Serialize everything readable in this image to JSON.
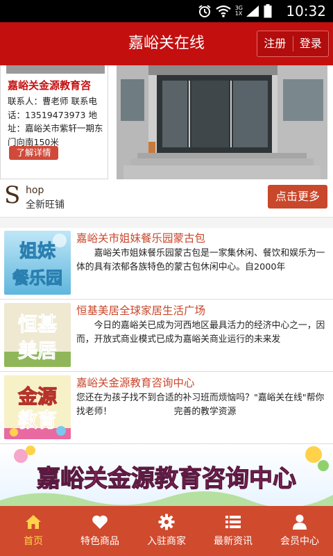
{
  "status_bar": {
    "time": "10:32",
    "network_top": "3G",
    "network_bottom": "1X"
  },
  "header": {
    "title": "嘉峪关在线",
    "register_label": "注册",
    "login_label": "登录"
  },
  "featured": {
    "name": "嘉峪关金源教育咨",
    "info": "联系人：曹老师 联系电话：13519473973 地址：嘉峪关市紫轩一期东门向南150米",
    "detail_label": "了解详情"
  },
  "shop": {
    "s_letter": "S",
    "hop": "hop",
    "subtitle": "全新旺铺",
    "more_label": "点击更多"
  },
  "list": [
    {
      "thumb_line1": "姐妹",
      "thumb_line2": "餐乐园",
      "title": "嘉峪关市姐妹餐乐园蒙古包",
      "desc": "　　嘉峪关市姐妹餐乐园蒙古包是一家集休闲、餐饮和娱乐为一体的具有浓郁各族特色的蒙古包休闲中心。自2000年"
    },
    {
      "thumb_line1": "恒基",
      "thumb_line2": "美居",
      "title": "恒基美居全球家居生活广场",
      "desc": "　　今日的嘉峪关已成为河西地区最具活力的经济中心之一，因而，开放式商业模式已成为嘉峪关商业运行的未来发"
    },
    {
      "thumb_line1": "金源",
      "thumb_line2": "教育",
      "title": "嘉峪关金源教育咨询中心",
      "desc": "您还在为孩子找不到合适的补习班而烦恼吗？\"嘉峪关在线\"帮你找老师！　　　　　　　完善的教学资源"
    }
  ],
  "banner": {
    "text": "嘉峪关金源教育咨询中心"
  },
  "nav": [
    {
      "label": "首页",
      "icon": "home-icon",
      "active": true
    },
    {
      "label": "特色商品",
      "icon": "heart-icon",
      "active": false
    },
    {
      "label": "入驻商家",
      "icon": "gear-icon",
      "active": false
    },
    {
      "label": "最新资讯",
      "icon": "list-icon",
      "active": false
    },
    {
      "label": "会员中心",
      "icon": "user-icon",
      "active": false
    }
  ],
  "colors": {
    "header_red": "#c40f0f",
    "accent_orange": "#c9472b",
    "nav_bg": "#d04a2e",
    "nav_active": "#ffd24a"
  }
}
